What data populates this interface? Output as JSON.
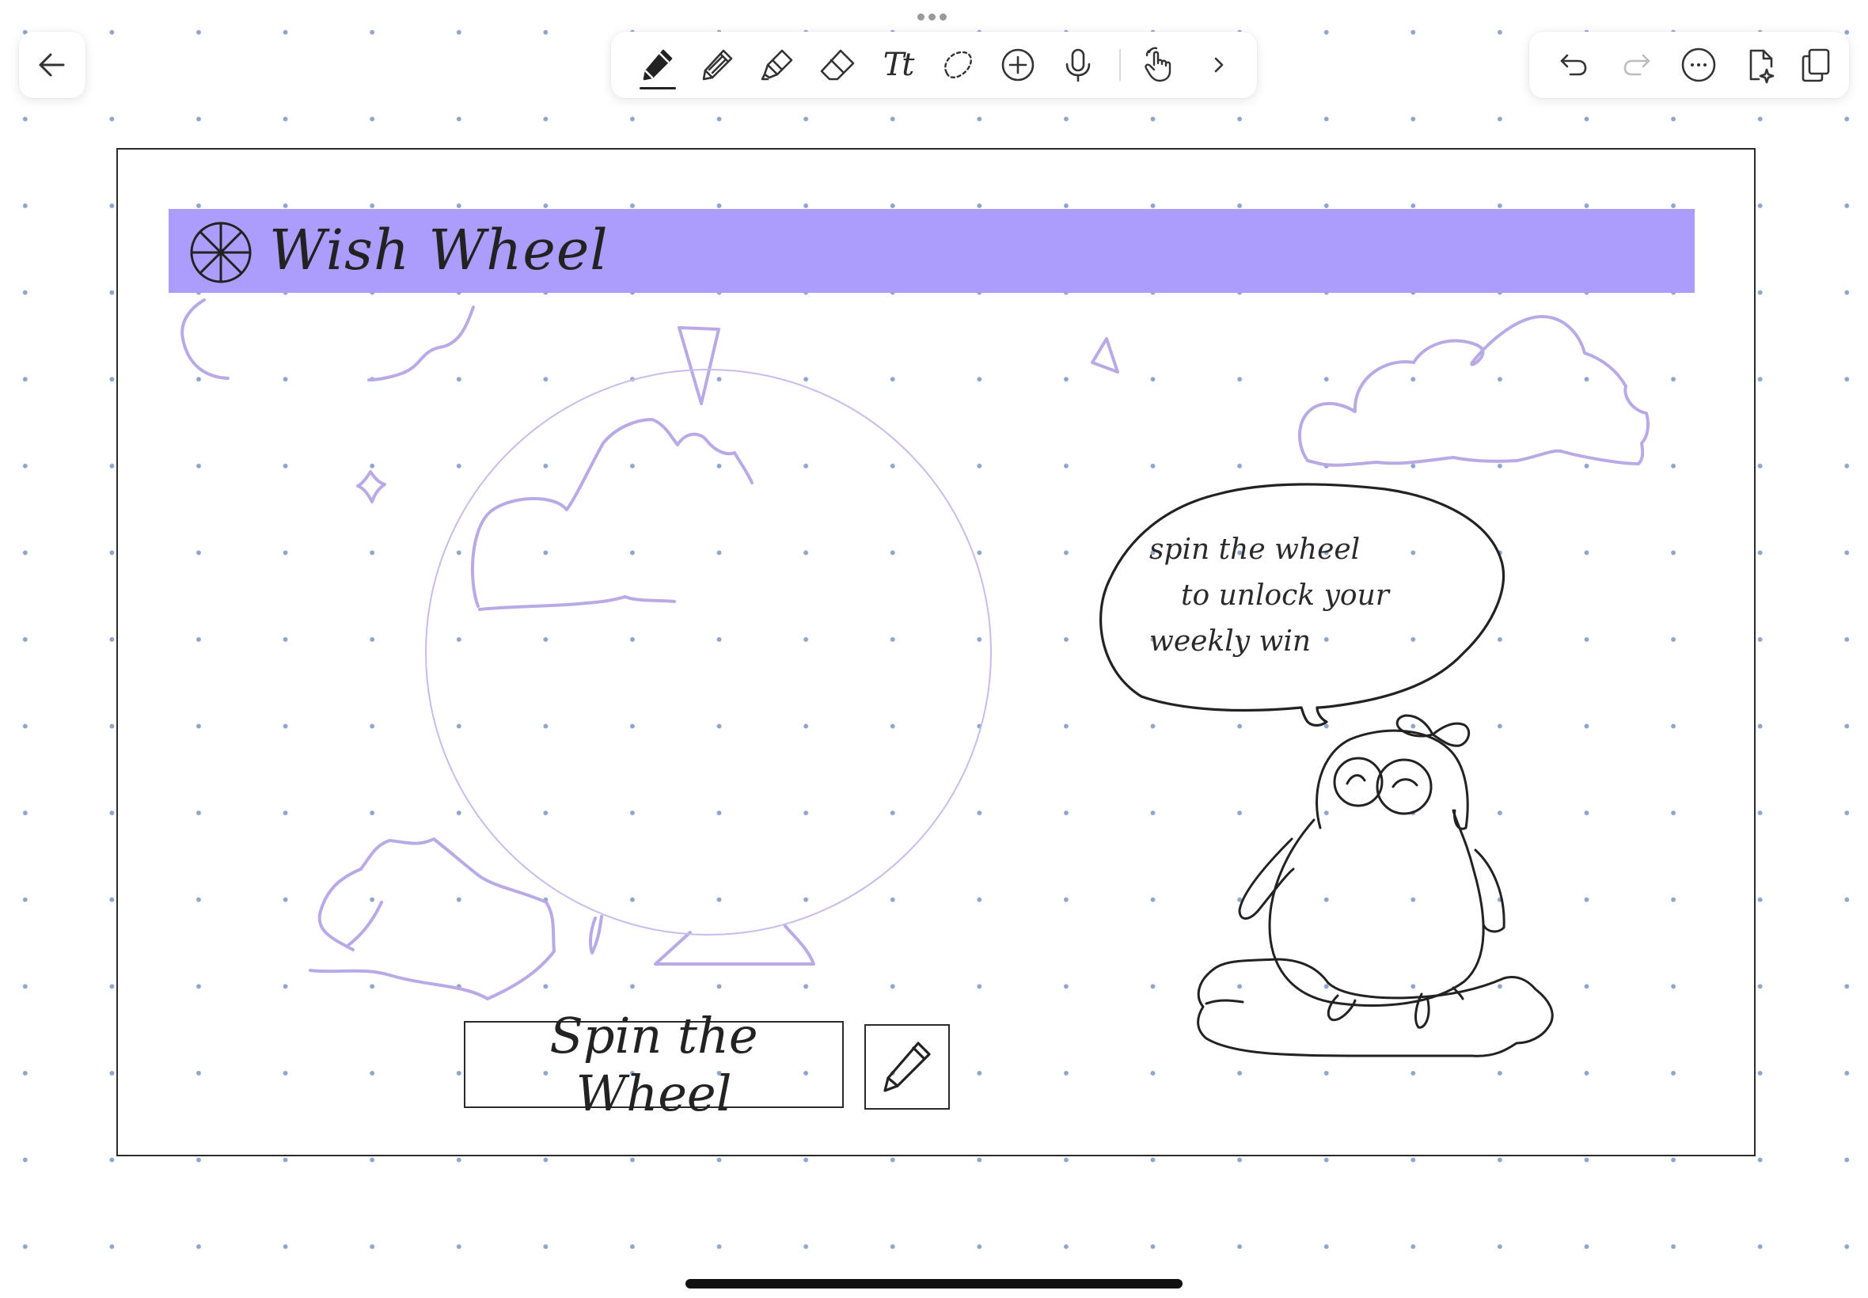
{
  "toolbar": {
    "back_icon": "arrow-left-icon",
    "tools": [
      {
        "name": "pen-tool",
        "icon": "pen-icon",
        "active": true
      },
      {
        "name": "pencil-tool",
        "icon": "pencil-icon"
      },
      {
        "name": "highlighter-tool",
        "icon": "highlighter-icon"
      },
      {
        "name": "eraser-tool",
        "icon": "eraser-icon"
      },
      {
        "name": "text-tool",
        "icon": "text-icon",
        "label": "Tt"
      },
      {
        "name": "lasso-tool",
        "icon": "lasso-icon"
      },
      {
        "name": "add-tool",
        "icon": "plus-circle-icon"
      },
      {
        "name": "audio-tool",
        "icon": "microphone-icon"
      },
      {
        "name": "touch-tool",
        "icon": "hand-pointer-icon"
      },
      {
        "name": "more-tools",
        "icon": "chevron-right-icon"
      }
    ],
    "right_actions": [
      "undo-icon",
      "redo-icon",
      "more-options-icon",
      "document-sparkle-icon",
      "pages-icon"
    ]
  },
  "canvas": {
    "title": "Wish Wheel",
    "speech_bubble_lines": [
      "spin the wheel",
      "to unlock your",
      "weekly win"
    ],
    "spin_button_label": "Spin the Wheel",
    "accent_color": "#ac9cfb",
    "sketch_color": "#b9aae6"
  }
}
